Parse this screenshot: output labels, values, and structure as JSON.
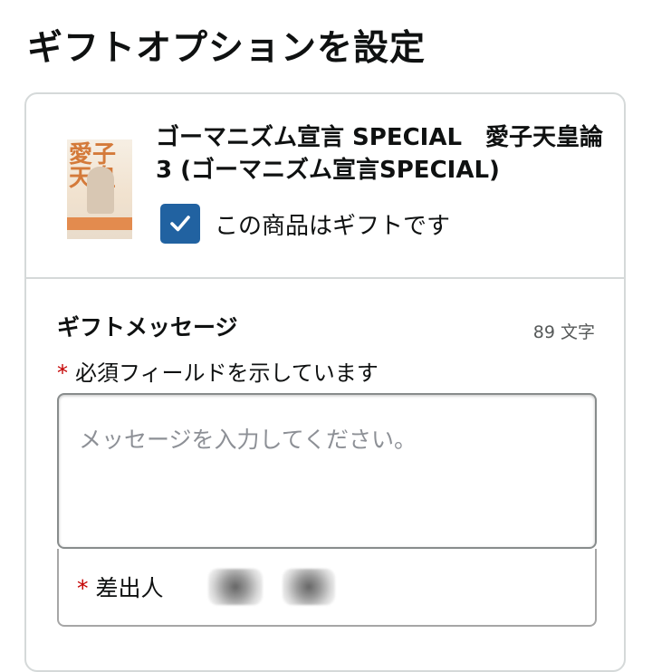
{
  "page": {
    "title": "ギフトオプションを設定"
  },
  "item": {
    "title": "ゴーマニズム宣言 SPECIAL　愛子天皇論3 (ゴーマニズム宣言SPECIAL)",
    "gift_checkbox_label": "この商品はギフトです",
    "gift_checked": true
  },
  "gift_message": {
    "heading": "ギフトメッセージ",
    "char_count": "89 文字",
    "required_asterisk": "*",
    "required_note": "必須フィールドを示しています",
    "placeholder": "メッセージを入力してください。",
    "sender_label": "差出人"
  }
}
